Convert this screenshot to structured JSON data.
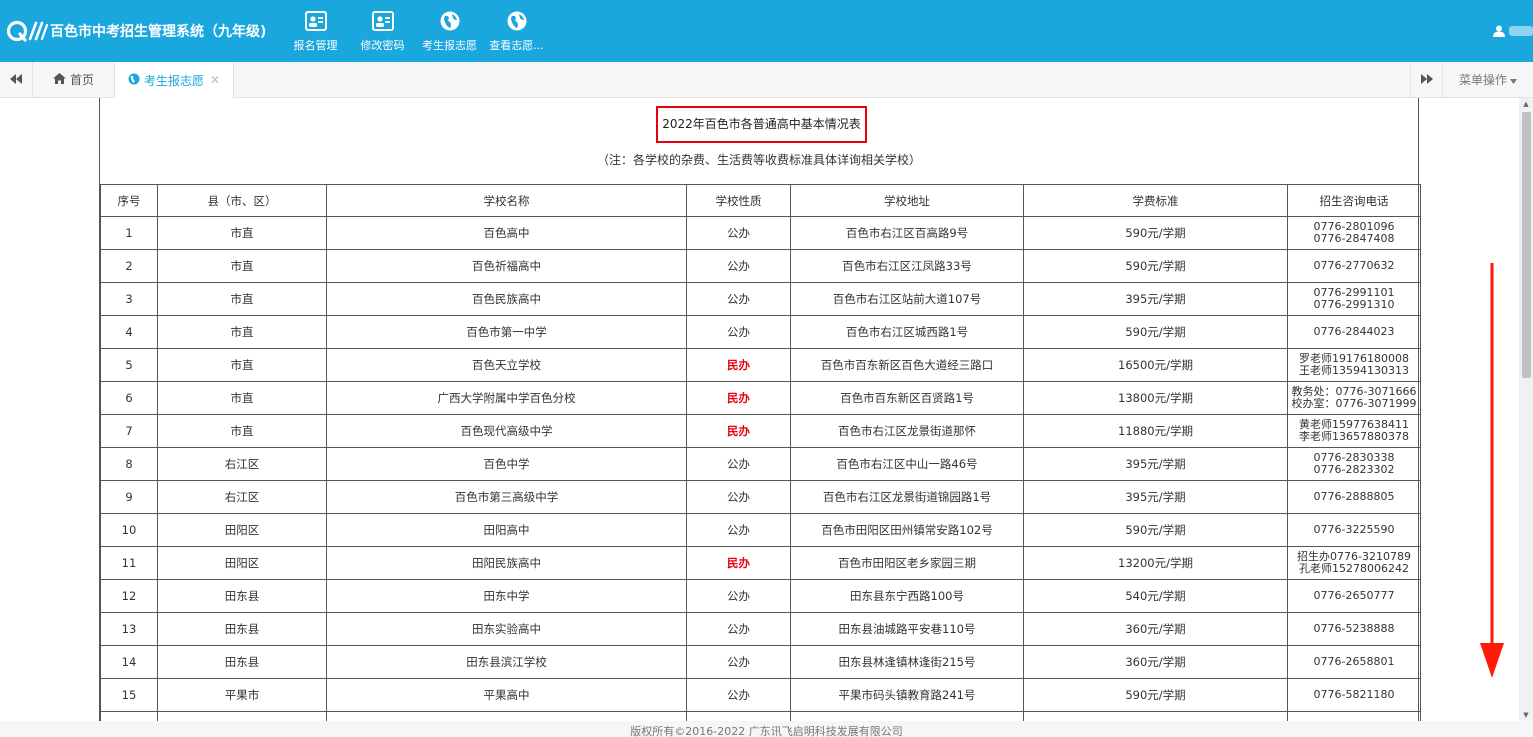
{
  "header": {
    "app_title": "百色市中考招生管理系统（九年级)",
    "nav": [
      {
        "label": "报名管理",
        "icon": "id-card-icon"
      },
      {
        "label": "修改密码",
        "icon": "id-card-icon"
      },
      {
        "label": "考生报志愿",
        "icon": "globe-icon"
      },
      {
        "label": "查看志愿...",
        "icon": "globe-icon"
      }
    ],
    "user_icon": "user-icon"
  },
  "tabbar": {
    "home_label": "首页",
    "active_tab_label": "考生报志愿",
    "menu_label": "菜单操作"
  },
  "document": {
    "title": "2022年百色市各普通高中基本情况表",
    "note": "（注：各学校的杂费、生活费等收费标准具体详询相关学校）",
    "columns": [
      "序号",
      "县（市、区）",
      "学校名称",
      "学校性质",
      "学校地址",
      "学费标准",
      "招生咨询电话"
    ],
    "rows": [
      {
        "no": "1",
        "county": "市直",
        "school": "百色高中",
        "type": "公办",
        "address": "百色市右江区百高路9号",
        "fee": "590元/学期",
        "phone1": "0776-2801096",
        "phone2": "0776-2847408"
      },
      {
        "no": "2",
        "county": "市直",
        "school": "百色祈福高中",
        "type": "公办",
        "address": "百色市右江区江凤路33号",
        "fee": "590元/学期",
        "phone1": "0776-2770632",
        "phone2": ""
      },
      {
        "no": "3",
        "county": "市直",
        "school": "百色民族高中",
        "type": "公办",
        "address": "百色市右江区站前大道107号",
        "fee": "395元/学期",
        "phone1": "0776-2991101",
        "phone2": "0776-2991310"
      },
      {
        "no": "4",
        "county": "市直",
        "school": "百色市第一中学",
        "type": "公办",
        "address": "百色市右江区城西路1号",
        "fee": "590元/学期",
        "phone1": "0776-2844023",
        "phone2": ""
      },
      {
        "no": "5",
        "county": "市直",
        "school": "百色天立学校",
        "type": "民办",
        "address": "百色市百东新区百色大道经三路口",
        "fee": "16500元/学期",
        "phone1": "罗老师19176180008",
        "phone2": "王老师13594130313"
      },
      {
        "no": "6",
        "county": "市直",
        "school": "广西大学附属中学百色分校",
        "type": "民办",
        "address": "百色市百东新区百贤路1号",
        "fee": "13800元/学期",
        "phone1": "教务处：0776-3071666",
        "phone2": "校办室：0776-3071999"
      },
      {
        "no": "7",
        "county": "市直",
        "school": "百色现代高级中学",
        "type": "民办",
        "address": "百色市右江区龙景街道那怀",
        "fee": "11880元/学期",
        "phone1": "黄老师15977638411",
        "phone2": "李老师13657880378"
      },
      {
        "no": "8",
        "county": "右江区",
        "school": "百色中学",
        "type": "公办",
        "address": "百色市右江区中山一路46号",
        "fee": "395元/学期",
        "phone1": "0776-2830338",
        "phone2": "0776-2823302"
      },
      {
        "no": "9",
        "county": "右江区",
        "school": "百色市第三高级中学",
        "type": "公办",
        "address": "百色市右江区龙景街道锦园路1号",
        "fee": "395元/学期",
        "phone1": "0776-2888805",
        "phone2": ""
      },
      {
        "no": "10",
        "county": "田阳区",
        "school": "田阳高中",
        "type": "公办",
        "address": "百色市田阳区田州镇常安路102号",
        "fee": "590元/学期",
        "phone1": "0776-3225590",
        "phone2": ""
      },
      {
        "no": "11",
        "county": "田阳区",
        "school": "田阳民族高中",
        "type": "民办",
        "address": "百色市田阳区老乡家园三期",
        "fee": "13200元/学期",
        "phone1": "招生办0776-3210789",
        "phone2": "孔老师15278006242"
      },
      {
        "no": "12",
        "county": "田东县",
        "school": "田东中学",
        "type": "公办",
        "address": "田东县东宁西路100号",
        "fee": "540元/学期",
        "phone1": "0776-2650777",
        "phone2": ""
      },
      {
        "no": "13",
        "county": "田东县",
        "school": "田东实验高中",
        "type": "公办",
        "address": "田东县油城路平安巷110号",
        "fee": "360元/学期",
        "phone1": "0776-5238888",
        "phone2": ""
      },
      {
        "no": "14",
        "county": "田东县",
        "school": "田东县滨江学校",
        "type": "公办",
        "address": "田东县林逢镇林逢街215号",
        "fee": "360元/学期",
        "phone1": "0776-2658801",
        "phone2": ""
      },
      {
        "no": "15",
        "county": "平果市",
        "school": "平果高中",
        "type": "公办",
        "address": "平果市码头镇教育路241号",
        "fee": "590元/学期",
        "phone1": "0776-5821180",
        "phone2": ""
      }
    ]
  },
  "footer": {
    "copyright": "版权所有©2016-2022 广东讯飞启明科技发展有限公司"
  },
  "colors": {
    "header_bg": "#1aa7de",
    "highlight_red": "#e60012",
    "private_school_red": "#e60012"
  }
}
